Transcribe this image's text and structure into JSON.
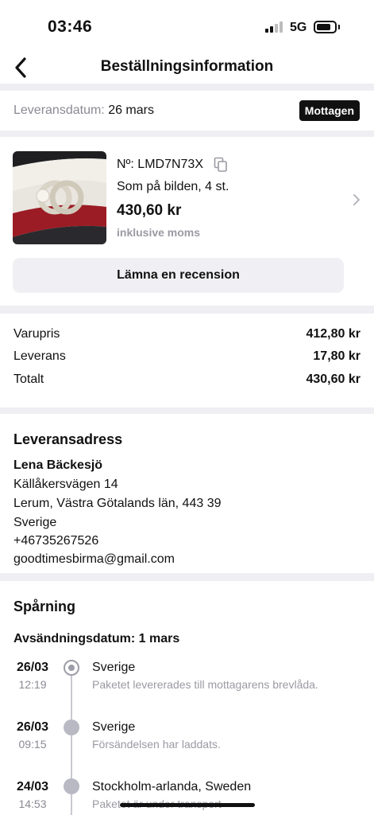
{
  "status_bar": {
    "time": "03:46",
    "network": "5G"
  },
  "nav": {
    "title": "Beställningsinformation",
    "back_icon": "chevron-left-icon"
  },
  "delivery": {
    "label": "Leveransdatum:",
    "date": "26 mars",
    "status": "Mottagen"
  },
  "product": {
    "order_number": "Nº: LMD7N73X",
    "variant": "Som på bilden, 4 st.",
    "price": "430,60 kr",
    "vat_note": "inklusive moms",
    "review_button": "Lämna en recension"
  },
  "totals": [
    {
      "label": "Varupris",
      "value": "412,80 kr"
    },
    {
      "label": "Leverans",
      "value": "17,80 kr"
    },
    {
      "label": "Totalt",
      "value": "430,60 kr"
    }
  ],
  "address": {
    "title": "Leveransadress",
    "name": "Lena Bäckesjö",
    "street": "Källåkersvägen 14",
    "city": "Lerum, Västra Götalands län, 443 39",
    "country": "Sverige",
    "phone": "+46735267526",
    "email": "goodtimesbirma@gmail.com"
  },
  "tracking": {
    "title": "Spårning",
    "ship_date": "Avsändningsdatum: 1 mars",
    "events": [
      {
        "date": "26/03",
        "time": "12:19",
        "location": "Sverige",
        "description": "Paketet levererades till mottagarens brevlåda."
      },
      {
        "date": "26/03",
        "time": "09:15",
        "location": "Sverige",
        "description": "Försändelsen har laddats."
      },
      {
        "date": "24/03",
        "time": "14:53",
        "location": "Stockholm-arlanda, Sweden",
        "description": "Paketet är under transport"
      }
    ]
  },
  "colors": {
    "badge_bg": "#111111",
    "muted_text": "#8a8a94",
    "divider": "#efeff3",
    "button_bg": "#f0f0f4"
  }
}
